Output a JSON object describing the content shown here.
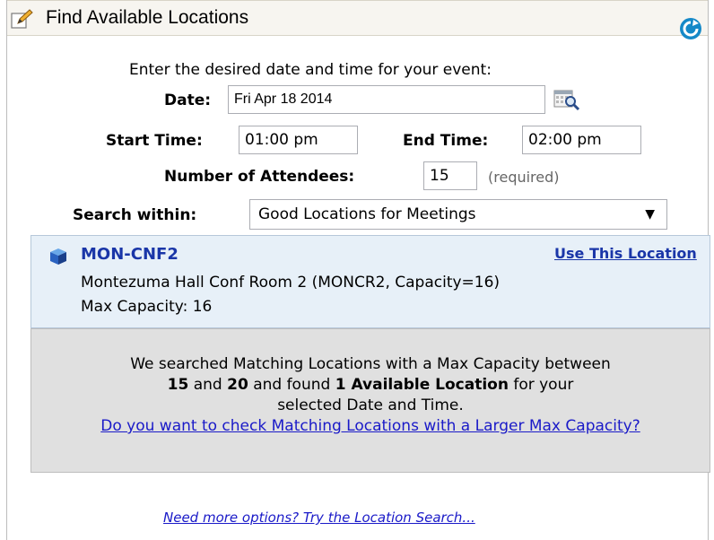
{
  "header": {
    "title": "Find Available Locations",
    "title_icon": "pencil-edit-icon",
    "refresh_icon": "refresh-icon"
  },
  "form": {
    "intro": "Enter the desired date and time for your event:",
    "date_label": "Date:",
    "date_value": "Fri Apr 18 2014",
    "calendar_icon": "calendar-search-icon",
    "start_label": "Start Time:",
    "start_value": "01:00 pm",
    "end_label": "End Time:",
    "end_value": "02:00 pm",
    "attendees_label": "Number of Attendees:",
    "attendees_value": "15",
    "attendees_note": "(required)",
    "search_label": "Search within:",
    "search_value": "Good Locations for Meetings"
  },
  "result": {
    "code": "MON-CNF2",
    "use_link": "Use This Location",
    "description": "Montezuma Hall Conf Room 2 (MONCR2, Capacity=16)",
    "max_capacity": "Max Capacity: 16"
  },
  "summary": {
    "part1": "We searched Matching Locations with a Max Capacity between",
    "min": "15",
    "and": "and",
    "max": "20",
    "found": "and found",
    "count_text": "1 Available Location",
    "part2": "for your",
    "part3": "selected Date and Time.",
    "link": "Do you want to check Matching Locations with a Larger Max Capacity?"
  },
  "footer": {
    "more_link": "Need more options? Try the Location Search..."
  },
  "colors": {
    "link": "#1a1ac8",
    "result_bg": "#e7f0f8",
    "summary_bg": "#e0e0e0",
    "refresh": "#1589c8"
  }
}
